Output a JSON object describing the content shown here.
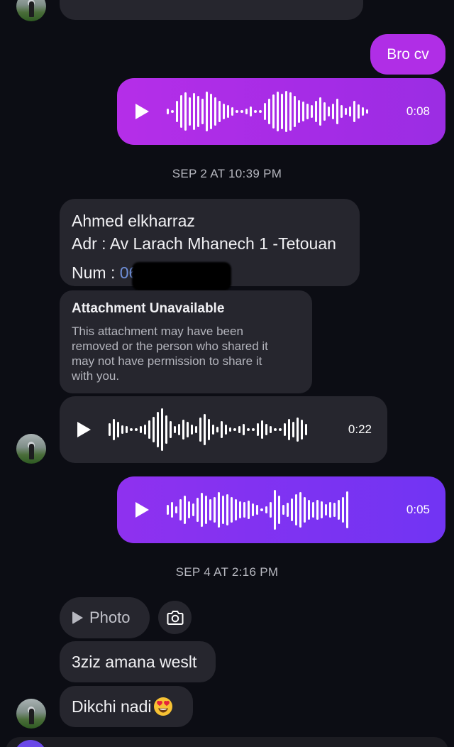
{
  "messages": {
    "out_text_1": "Bro cv",
    "out_voice_1_duration": "0:08",
    "sep2_timestamp": "SEP 2 AT 10:39 PM",
    "in_card": {
      "line1": "Ahmed elkharraz",
      "line2": "Adr : Av Larach Mhanech 1 -Tetouan",
      "line3_label": "Num : ",
      "line3_visible_digits": "06"
    },
    "attachment": {
      "title": "Attachment Unavailable",
      "line1": "This attachment may have been",
      "line2": "removed or the person who shared it",
      "line3": "may not have permission to share it",
      "line4": "with you."
    },
    "in_voice_duration": "0:22",
    "out_voice_2_duration": "0:05",
    "sep4_timestamp": "SEP 4 AT 2:16 PM",
    "photo_label": "Photo",
    "in_text_1": "3ziz amana weslt",
    "in_text_2": "Dikchi nadi",
    "emoji_name": "heart-eyes-emoji"
  },
  "colors": {
    "background": "#0c0d14",
    "incoming_bubble": "#26262e",
    "outgoing_magenta": "#a72de6",
    "outgoing_violet": "#7a33f2"
  }
}
